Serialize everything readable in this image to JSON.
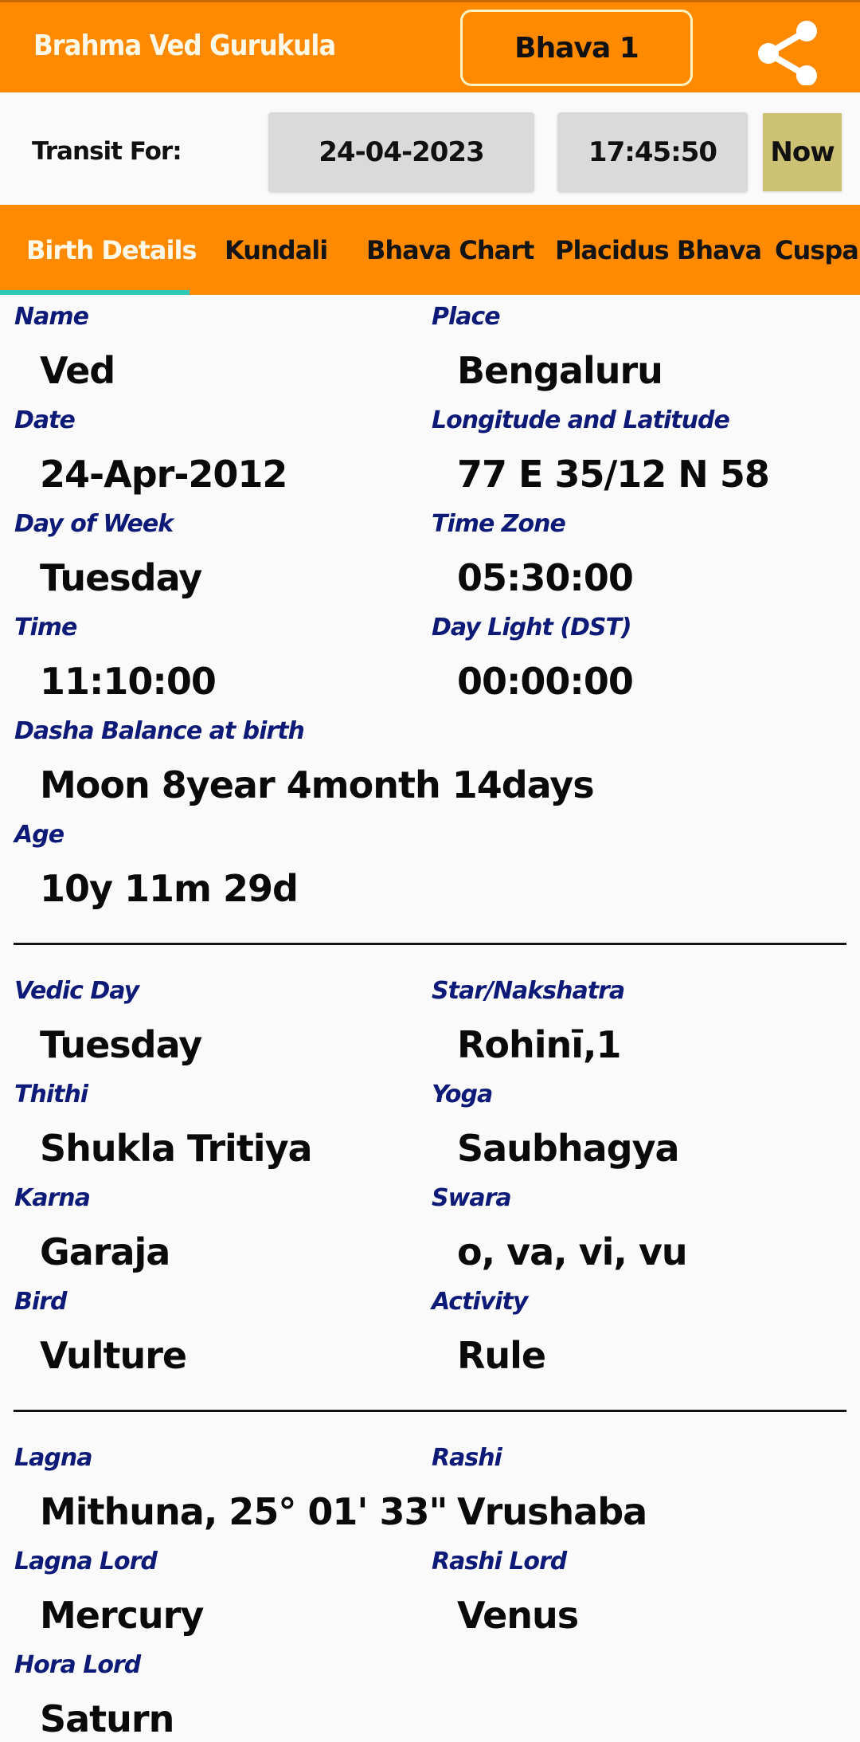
{
  "header": {
    "title": "Brahma Ved Gurukula",
    "bhava_button": "Bhava 1",
    "share_icon": "share-icon"
  },
  "transit": {
    "label": "Transit For:",
    "date": "24-04-2023",
    "time": "17:45:50",
    "now_button": "Now"
  },
  "tabs": [
    {
      "label": "Birth Details",
      "active": true
    },
    {
      "label": "Kundali",
      "active": false
    },
    {
      "label": "Bhava Chart",
      "active": false
    },
    {
      "label": "Placidus Bhava",
      "active": false
    },
    {
      "label": "Cuspal L",
      "active": false
    }
  ],
  "colors": {
    "brand_orange": "#ff8a00",
    "tab_indicator": "#2ec9b4",
    "label_navy": "#0d1a78",
    "now_button": "#cdc174",
    "pill_gray": "#d9dad9"
  },
  "birth": {
    "name": {
      "label": "Name",
      "value": "Ved"
    },
    "place": {
      "label": "Place",
      "value": "Bengaluru"
    },
    "date": {
      "label": "Date",
      "value": "24-Apr-2012"
    },
    "lonlat": {
      "label": "Longitude and Latitude",
      "value": "77 E 35/12 N 58"
    },
    "dow": {
      "label": "Day of Week",
      "value": "Tuesday"
    },
    "tz": {
      "label": "Time Zone",
      "value": "05:30:00"
    },
    "time": {
      "label": "Time",
      "value": "11:10:00"
    },
    "dst": {
      "label": "Day Light (DST)",
      "value": "00:00:00"
    },
    "dasha": {
      "label": "Dasha Balance at birth",
      "value": "Moon 8year 4month 14days"
    },
    "age": {
      "label": "Age",
      "value": "10y 11m 29d"
    }
  },
  "panchang": {
    "vedic_day": {
      "label": "Vedic Day",
      "value": "Tuesday"
    },
    "star": {
      "label": "Star/Nakshatra",
      "value": "Rohinī,1"
    },
    "thithi": {
      "label": "Thithi",
      "value": "Shukla Tritiya"
    },
    "yoga": {
      "label": "Yoga",
      "value": "Saubhagya"
    },
    "karna": {
      "label": "Karna",
      "value": "Garaja"
    },
    "swara": {
      "label": "Swara",
      "value": "o, va, vi, vu"
    },
    "bird": {
      "label": "Bird",
      "value": "Vulture"
    },
    "activity": {
      "label": "Activity",
      "value": "Rule"
    }
  },
  "lagna": {
    "lagna": {
      "label": "Lagna",
      "value": "Mithuna, 25° 01' 33\""
    },
    "rashi": {
      "label": "Rashi",
      "value": "Vrushaba"
    },
    "lagna_lord": {
      "label": "Lagna Lord",
      "value": "Mercury"
    },
    "rashi_lord": {
      "label": "Rashi Lord",
      "value": "Venus"
    },
    "hora_lord": {
      "label": "Hora Lord",
      "value": "Saturn"
    }
  }
}
